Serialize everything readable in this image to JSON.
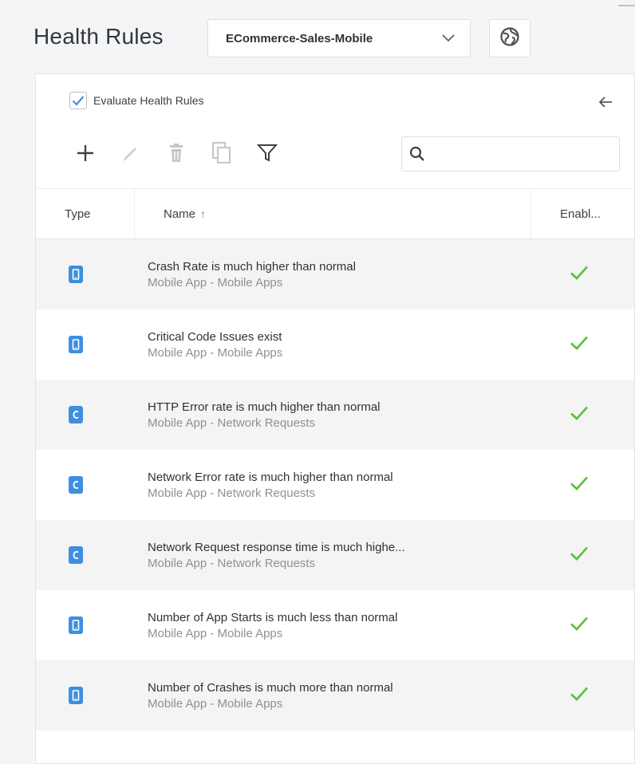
{
  "header": {
    "title": "Health Rules",
    "app_selector": {
      "value": "ECommerce-Sales-Mobile"
    }
  },
  "panel": {
    "evaluate": {
      "label": "Evaluate Health Rules",
      "checked": true
    },
    "search": {
      "placeholder": "",
      "value": ""
    },
    "table": {
      "columns": {
        "type": "Type",
        "name": "Name",
        "sort_indicator": "↑",
        "enabled": "Enabl..."
      },
      "rows": [
        {
          "type_icon": "mobile-app-icon",
          "name": "Crash Rate is much higher than normal",
          "sub": "Mobile App - Mobile Apps",
          "enabled": true
        },
        {
          "type_icon": "mobile-app-icon",
          "name": "Critical Code Issues exist",
          "sub": "Mobile App - Mobile Apps",
          "enabled": true
        },
        {
          "type_icon": "network-request-icon",
          "name": "HTTP Error rate is much higher than normal",
          "sub": "Mobile App - Network Requests",
          "enabled": true
        },
        {
          "type_icon": "network-request-icon",
          "name": "Network Error rate is much higher than normal",
          "sub": "Mobile App - Network Requests",
          "enabled": true
        },
        {
          "type_icon": "network-request-icon",
          "name": "Network Request response time is much highe...",
          "sub": "Mobile App - Network Requests",
          "enabled": true
        },
        {
          "type_icon": "mobile-app-icon",
          "name": "Number of App Starts is much less than normal",
          "sub": "Mobile App - Mobile Apps",
          "enabled": true
        },
        {
          "type_icon": "mobile-app-icon",
          "name": "Number of Crashes is much more than normal",
          "sub": "Mobile App - Mobile Apps",
          "enabled": true
        }
      ]
    }
  },
  "colors": {
    "accent": "#3d8fe0",
    "enabled_check": "#5cc33b",
    "icon_muted": "#a7acb2"
  }
}
